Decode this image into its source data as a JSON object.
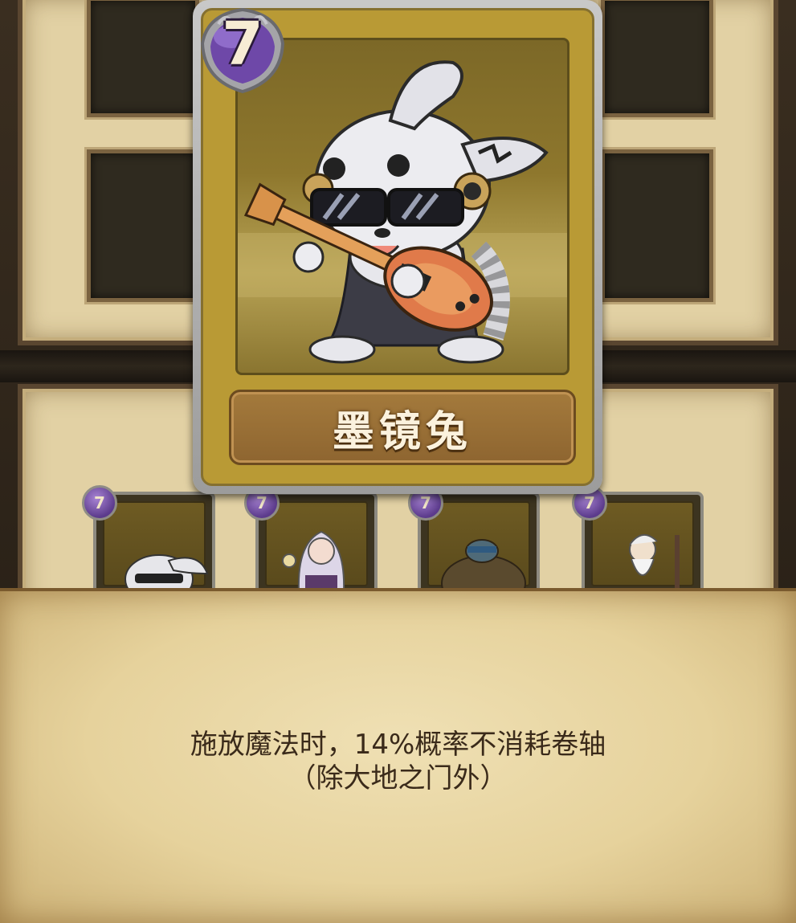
{
  "card": {
    "cost": "7",
    "name": "墨镜兔"
  },
  "mini_cards": [
    {
      "cost": "7",
      "icon": "rabbit-sunglasses-icon"
    },
    {
      "cost": "7",
      "icon": "girl-icon"
    },
    {
      "cost": "7",
      "icon": "turtle-icon"
    },
    {
      "cost": "7",
      "icon": "old-sage-icon"
    }
  ],
  "description": {
    "line1": "施放魔法时，14%概率不消耗卷轴",
    "line2": "（除大地之门外）"
  },
  "colors": {
    "cost_badge": "#6e48a8",
    "card_frame": "#b0b0b0",
    "card_body": "#b99a35",
    "name_plate": "#9a7036",
    "parchment": "#e8d6a3"
  }
}
